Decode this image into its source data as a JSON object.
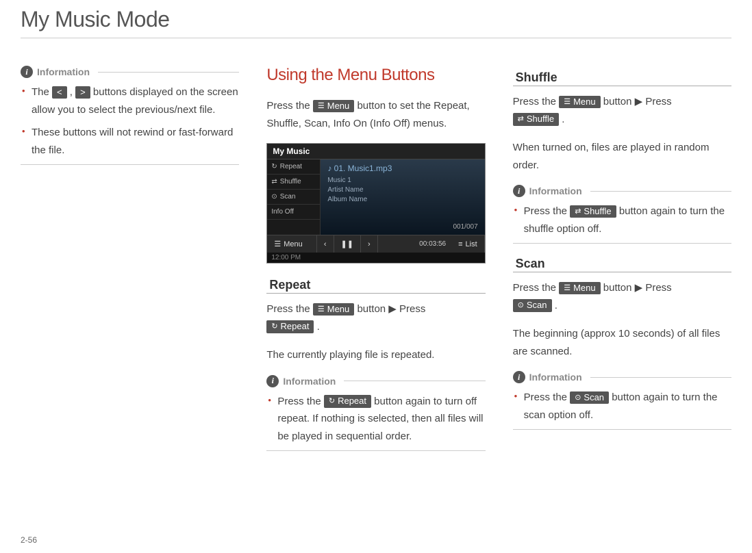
{
  "page": {
    "title": "My Music Mode",
    "pageNumber": "2-56"
  },
  "col1": {
    "info1": {
      "label": "Information",
      "items": [
        {
          "pre": "The ",
          "chip1": "<",
          "mid": " , ",
          "chip2": ">",
          "post": " buttons displayed on the screen allow you to select the previous/next file."
        },
        {
          "text": "These buttons will not rewind or fast-forward the file."
        }
      ]
    }
  },
  "col2": {
    "heading": "Using the Menu Buttons",
    "intro": {
      "pre": "Press the ",
      "chip": "Menu",
      "post": " button to set the Repeat, Shuffle, Scan, Info On (Info Off) menus."
    },
    "screenshot": {
      "title": "My Music",
      "sideItems": [
        "Repeat",
        "Shuffle",
        "Scan",
        "Info Off"
      ],
      "track": "♪ 01. Music1.mp3",
      "meta1": "Music 1",
      "meta2": "Artist Name",
      "meta3": "Album Name",
      "counter": "001/007",
      "menuBtn": "Menu",
      "listBtn": "List",
      "time": "00:03:56",
      "clock": "12:00 PM"
    },
    "repeat": {
      "heading": "Repeat",
      "line": {
        "pre": "Press the ",
        "chip1": "Menu",
        "mid": " button ▶ Press ",
        "chip2": "Repeat",
        "post": " ."
      },
      "body": "The currently playing file is repeated.",
      "info": {
        "label": "Information",
        "item": {
          "pre": "Press the ",
          "chip": "Repeat",
          "post": " button again to turn off repeat. If nothing is selected, then all files will be played in sequential order."
        }
      }
    }
  },
  "col3": {
    "shuffle": {
      "heading": "Shuffle",
      "line": {
        "pre": "Press the ",
        "chip1": "Menu",
        "mid": " button ▶ Press ",
        "chip2": "Shuffle",
        "post": " ."
      },
      "body": "When turned on, files are played in random order.",
      "info": {
        "label": "Information",
        "item": {
          "pre": "Press the ",
          "chip": "Shuffle",
          "post": " button again to turn the shuffle option off."
        }
      }
    },
    "scan": {
      "heading": "Scan",
      "line": {
        "pre": "Press the ",
        "chip1": "Menu",
        "mid": " button ▶ Press ",
        "chip2": "Scan",
        "post": " ."
      },
      "body": "The beginning (approx 10 seconds) of all files are scanned.",
      "info": {
        "label": "Information",
        "item": {
          "pre": "Press the ",
          "chip": "Scan",
          "post": " button again to turn the scan option off."
        }
      }
    }
  },
  "icons": {
    "menu": "☰",
    "repeat": "↻",
    "shuffle": "⇄",
    "scan": "⊙",
    "prev": "<",
    "next": ">",
    "note": "♪",
    "person": "•",
    "disc": "◉",
    "list": "≡"
  }
}
